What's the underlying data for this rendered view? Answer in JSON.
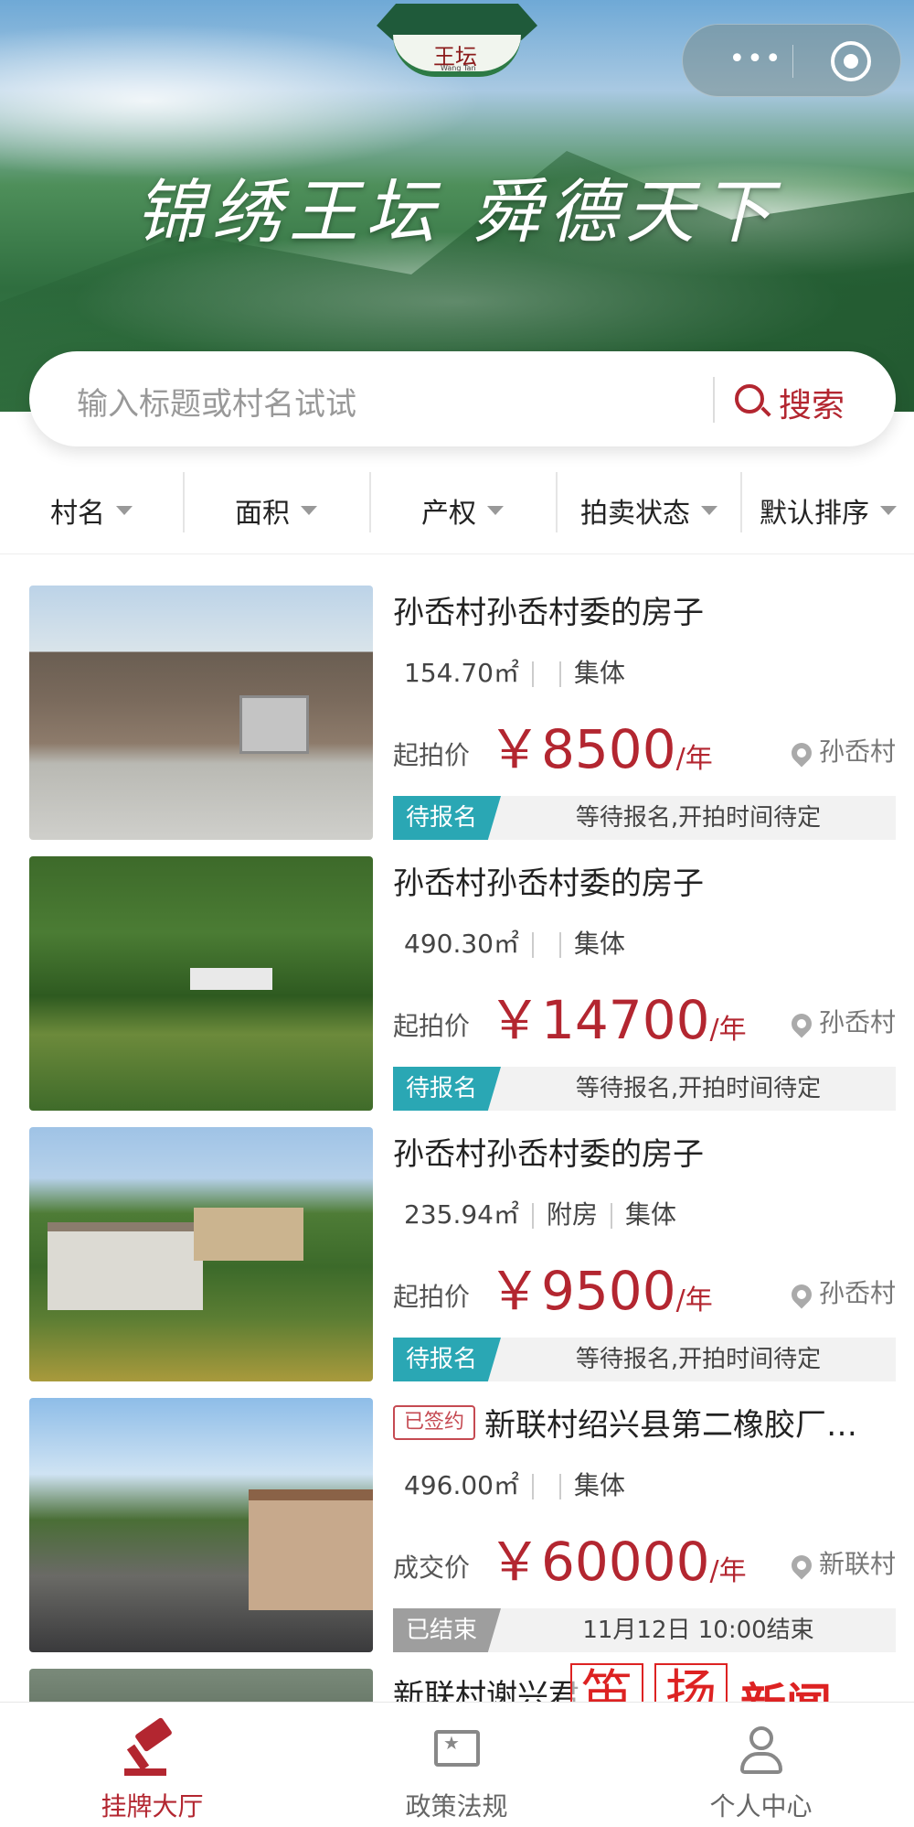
{
  "banner": {
    "logo_text": "王坛",
    "logo_sub": "Wang Tan",
    "slogan": "锦绣王坛  舜德天下"
  },
  "capsule": {
    "more_glyph": "•••"
  },
  "search": {
    "placeholder": "输入标题或村名试试",
    "button_label": "搜索"
  },
  "filters": [
    "村名",
    "面积",
    "产权",
    "拍卖状态",
    "默认排序"
  ],
  "listings": [
    {
      "title": "孙岙村孙岙村委的房子",
      "area": "154.70㎡",
      "type": "",
      "ownership": "集体",
      "price_label": "起拍价",
      "price": "￥8500",
      "price_unit": "/年",
      "village": "孙岙村",
      "status_tag": "待报名",
      "status_text": "等待报名,开拍时间待定"
    },
    {
      "title": "孙岙村孙岙村委的房子",
      "area": "490.30㎡",
      "type": "",
      "ownership": "集体",
      "price_label": "起拍价",
      "price": "￥14700",
      "price_unit": "/年",
      "village": "孙岙村",
      "status_tag": "待报名",
      "status_text": "等待报名,开拍时间待定"
    },
    {
      "title": "孙岙村孙岙村委的房子",
      "area": "235.94㎡",
      "type": "附房",
      "ownership": "集体",
      "price_label": "起拍价",
      "price": "￥9500",
      "price_unit": "/年",
      "village": "孙岙村",
      "status_tag": "待报名",
      "status_text": "等待报名,开拍时间待定"
    },
    {
      "badge": "已签约",
      "title": "新联村绍兴县第二橡胶厂…",
      "area": "496.00㎡",
      "type": "",
      "ownership": "集体",
      "price_label": "成交价",
      "price": "￥60000",
      "price_unit": "/年",
      "village": "新联村",
      "status_tag": "已结束",
      "status_text": "11月12日 10:00结束"
    },
    {
      "title": "新联村谢兴君"
    }
  ],
  "tabbar": {
    "tabs": [
      {
        "label": "挂牌大厅",
        "icon": "gavel-icon"
      },
      {
        "label": "政策法规",
        "icon": "policy-book-icon"
      },
      {
        "label": "个人中心",
        "icon": "user-icon"
      }
    ]
  },
  "watermark": {
    "char1": "笛",
    "char2": "扬",
    "word": "新闻"
  },
  "colors": {
    "accent": "#b32630",
    "pending": "#2aa7b4",
    "ended": "#9e9e9e"
  }
}
